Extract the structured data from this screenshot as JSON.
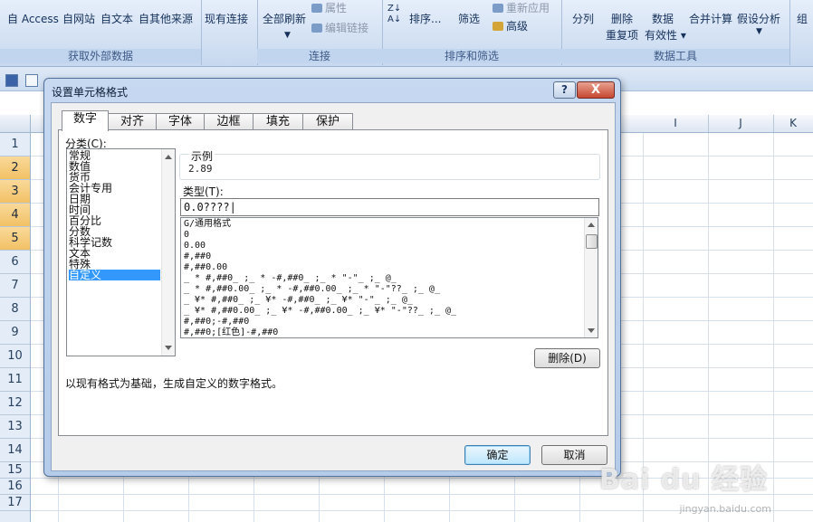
{
  "ribbon": {
    "get_external": {
      "buttons": [
        "自 Access",
        "自网站",
        "自文本",
        "自其他来源"
      ],
      "group_label": "获取外部数据"
    },
    "connections": {
      "existing": "现有连接",
      "refresh_all": "全部刷新",
      "properties": "属性",
      "edit_links": "编辑链接",
      "group_label": "连接"
    },
    "sort_filter": {
      "sort": "排序...",
      "filter": "筛选",
      "reapply": "重新应用",
      "advanced": "高级",
      "group_label": "排序和筛选"
    },
    "data_tools": {
      "text_to_columns": "分列",
      "remove_dup_line1": "删除",
      "remove_dup_line2": "重复项",
      "validation_line1": "数据",
      "validation_line2": "有效性",
      "consolidate": "合并计算",
      "what_if": "假设分析",
      "group_label": "数据工具"
    },
    "outline_partial": "组"
  },
  "grid": {
    "columns": [
      "I",
      "J",
      "K"
    ],
    "rows": [
      "1",
      "2",
      "3",
      "4",
      "5",
      "6",
      "7",
      "8",
      "9",
      "10",
      "11",
      "12",
      "13",
      "14",
      "15",
      "16",
      "17"
    ],
    "selected_rows": [
      "2",
      "3",
      "4",
      "5"
    ]
  },
  "dialog": {
    "title": "设置单元格格式",
    "help": "?",
    "close": "X",
    "tabs": [
      "数字",
      "对齐",
      "字体",
      "边框",
      "填充",
      "保护"
    ],
    "active_tab": "数字",
    "category_label": "分类(C):",
    "categories": [
      "常规",
      "数值",
      "货币",
      "会计专用",
      "日期",
      "时间",
      "百分比",
      "分数",
      "科学记数",
      "文本",
      "特殊",
      "自定义"
    ],
    "selected_category": "自定义",
    "sample_label": "示例",
    "sample_value": "2.89",
    "type_label": "类型(T):",
    "type_value": "0.0????|",
    "formats": [
      "G/通用格式",
      "0",
      "0.00",
      "#,##0",
      "#,##0.00",
      "_ * #,##0_ ;_ * -#,##0_ ;_ * \"-\"_ ;_ @_",
      "_ * #,##0.00_ ;_ * -#,##0.00_ ;_ * \"-\"??_ ;_ @_",
      "_ ¥* #,##0_ ;_ ¥* -#,##0_ ;_ ¥* \"-\"_ ;_ @_",
      "_ ¥* #,##0.00_ ;_ ¥* -#,##0.00_ ;_ ¥* \"-\"??_ ;_ @_",
      "#,##0;-#,##0",
      "#,##0;[红色]-#,##0"
    ],
    "delete_button": "删除(D)",
    "description": "以现有格式为基础，生成自定义的数字格式。",
    "ok_button": "确定",
    "cancel_button": "取消"
  },
  "watermark": {
    "logo": "Bai du 经验",
    "url": "jingyan.baidu.com"
  }
}
